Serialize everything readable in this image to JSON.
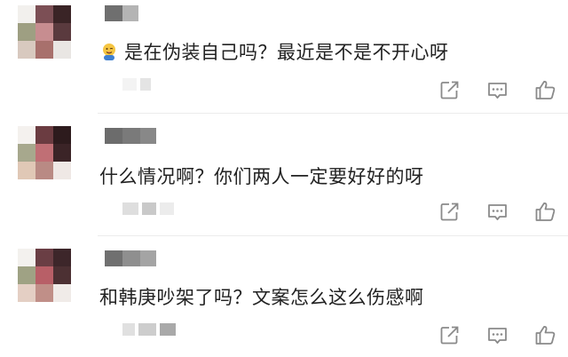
{
  "comments": [
    {
      "avatar": [
        "#f2f0ed",
        "#7c4f55",
        "#3a2426",
        "#9e9f82",
        "#c78d90",
        "#5a3a3e",
        "#d8c9bf",
        "#a8706c",
        "#e9e6e3"
      ],
      "name_blocks": [
        "#6f6f6f",
        "#b4b4b4"
      ],
      "emoji": "😜",
      "text": "是在伪装自己吗？最近是不是不开心呀",
      "meta_blocks": [
        "#f3f3f3",
        "#e4e4e4"
      ]
    },
    {
      "avatar": [
        "#f4f1ee",
        "#6b3c41",
        "#2d1b1d",
        "#a7a88d",
        "#c06f75",
        "#3b2427",
        "#e0c8b6",
        "#b98a84",
        "#efe8e5"
      ],
      "name_blocks": [
        "#6c6c6c",
        "#7a7a7a",
        "#888888"
      ],
      "emoji": "",
      "text": "什么情况啊？你们两人一定要好好的呀",
      "meta_blocks": [
        "#dedede",
        "#c9c9c9",
        "#ececec"
      ]
    },
    {
      "avatar": [
        "#f3f1ee",
        "#6a3e44",
        "#3d262a",
        "#9fa284",
        "#b85f67",
        "#4c3033",
        "#e4cfc4",
        "#c08f88",
        "#f0ebe8"
      ],
      "name_blocks": [
        "#707070",
        "#8f8f8f",
        "#a4a4a4"
      ],
      "emoji": "",
      "text": "和韩庚吵架了吗？文案怎么这么伤感啊",
      "meta_blocks": [
        "#e0e0e0",
        "#cdcdcd",
        "#a9a9a9"
      ]
    }
  ],
  "icon_color": "#8a8a8a",
  "actions": [
    "share-icon",
    "comment-icon",
    "like-icon"
  ]
}
